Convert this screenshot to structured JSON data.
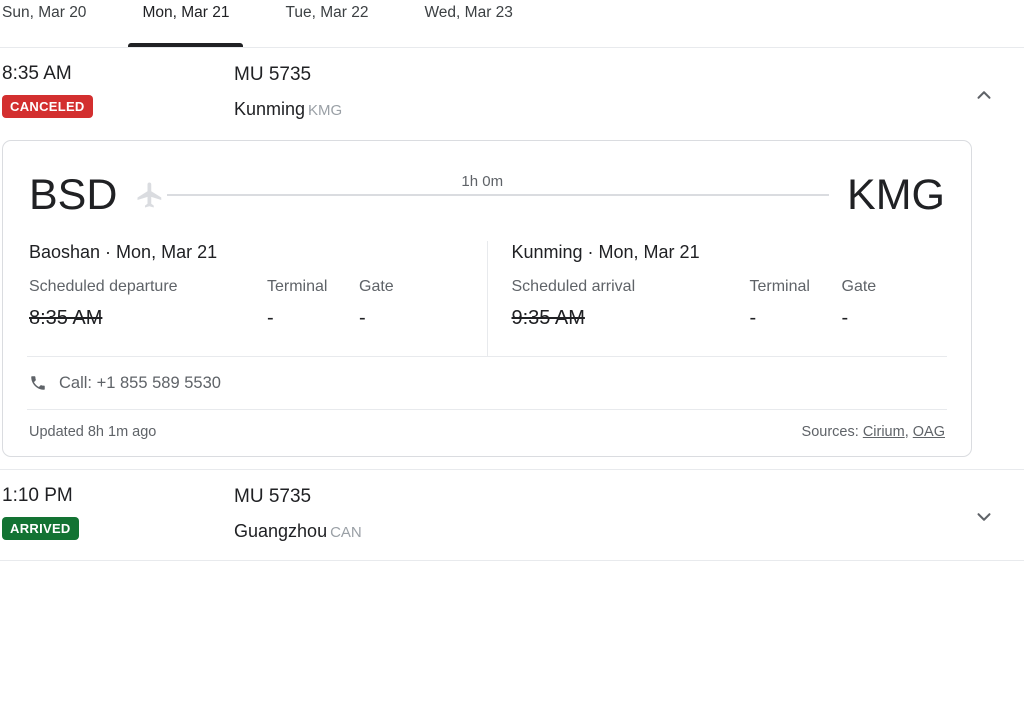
{
  "date_tabs": [
    {
      "label": "Sun, Mar 20",
      "active": false
    },
    {
      "label": "Mon, Mar 21",
      "active": true
    },
    {
      "label": "Tue, Mar 22",
      "active": false
    },
    {
      "label": "Wed, Mar 23",
      "active": false
    }
  ],
  "colors": {
    "canceled_badge": "#d32f2f",
    "arrived_badge": "#137333",
    "divider": "#e8eaed",
    "card_border": "#dadce0",
    "muted_text": "#5f6368",
    "primary_text": "#202124",
    "route_line": "#dadce0",
    "plane_icon": "#dadce0"
  },
  "flights": [
    {
      "time": "8:35 AM",
      "status": "CANCELED",
      "status_color": "#d32f2f",
      "flight_number": "MU 5735",
      "destination_city": "Kunming",
      "destination_code": "KMG",
      "toggle_icon": "chevron-up-icon",
      "expanded": true
    },
    {
      "time": "1:10 PM",
      "status": "ARRIVED",
      "status_color": "#137333",
      "flight_number": "MU 5735",
      "destination_city": "Guangzhou",
      "destination_code": "CAN",
      "toggle_icon": "chevron-down-icon",
      "expanded": false
    }
  ],
  "detail_card": {
    "origin_code": "BSD",
    "destination_code": "KMG",
    "duration": "1h 0m",
    "plane_icon": "airplane-icon",
    "departure": {
      "title": "Baoshan · Mon, Mar 21",
      "time_label": "Scheduled departure",
      "time_value": "8:35 AM",
      "terminal_label": "Terminal",
      "terminal_value": "-",
      "gate_label": "Gate",
      "gate_value": "-"
    },
    "arrival": {
      "title": "Kunming · Mon, Mar 21",
      "time_label": "Scheduled arrival",
      "time_value": "9:35 AM",
      "terminal_label": "Terminal",
      "terminal_value": "-",
      "gate_label": "Gate",
      "gate_value": "-"
    },
    "call": {
      "icon": "phone-icon",
      "text": "Call: +1 855 589 5530"
    },
    "footer": {
      "updated": "Updated 8h 1m ago",
      "sources_label": "Sources:",
      "sources": [
        {
          "name": "Cirium"
        },
        {
          "name": "OAG"
        }
      ],
      "separator": ","
    }
  }
}
